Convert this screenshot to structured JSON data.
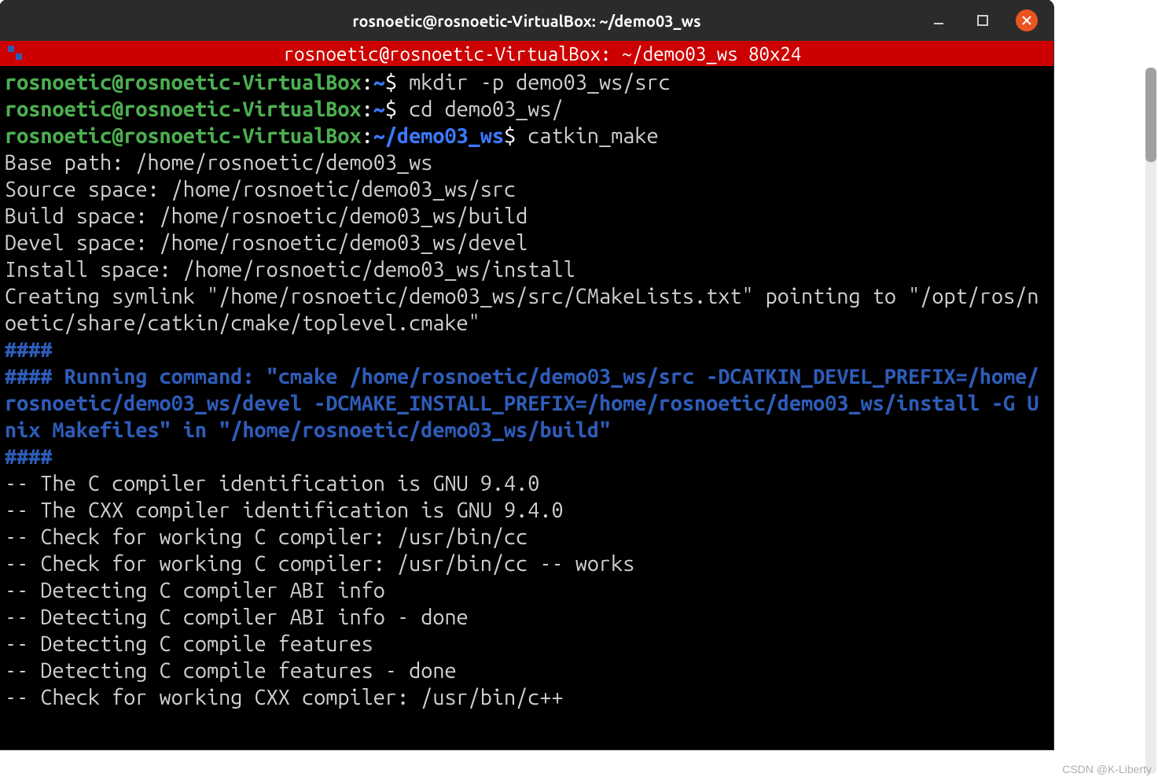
{
  "window": {
    "title": "rosnoetic@rosnoetic-VirtualBox: ~/demo03_ws"
  },
  "tabbar": {
    "text": "rosnoetic@rosnoetic-VirtualBox: ~/demo03_ws 80x24"
  },
  "prompts": {
    "user_host": "rosnoetic@rosnoetic-VirtualBox",
    "home_tilde": "~",
    "cwd": "~/demo03_ws",
    "dollar": "$"
  },
  "commands": {
    "mkdir": " mkdir -p demo03_ws/src",
    "cd": " cd demo03_ws/",
    "catkin": " catkin_make"
  },
  "output": {
    "lines_plain_1": "Base path: /home/rosnoetic/demo03_ws\nSource space: /home/rosnoetic/demo03_ws/src\nBuild space: /home/rosnoetic/demo03_ws/build\nDevel space: /home/rosnoetic/demo03_ws/devel\nInstall space: /home/rosnoetic/demo03_ws/install\nCreating symlink \"/home/rosnoetic/demo03_ws/src/CMakeLists.txt\" pointing to \"/opt/ros/noetic/share/catkin/cmake/toplevel.cmake\"",
    "hashes": "####",
    "running_prefix": "#### Running command: ",
    "running_cmd": "\"cmake /home/rosnoetic/demo03_ws/src -DCATKIN_DEVEL_PREFIX=/home/rosnoetic/demo03_ws/devel -DCMAKE_INSTALL_PREFIX=/home/rosnoetic/demo03_ws/install -G Unix Makefiles\"",
    "in_word": " in ",
    "in_path": "\"/home/rosnoetic/demo03_ws/build\"",
    "lines_plain_2": "-- The C compiler identification is GNU 9.4.0\n-- The CXX compiler identification is GNU 9.4.0\n-- Check for working C compiler: /usr/bin/cc\n-- Check for working C compiler: /usr/bin/cc -- works\n-- Detecting C compiler ABI info\n-- Detecting C compiler ABI info - done\n-- Detecting C compile features\n-- Detecting C compile features - done\n-- Check for working CXX compiler: /usr/bin/c++"
  },
  "watermark": "CSDN @K-Liberty"
}
